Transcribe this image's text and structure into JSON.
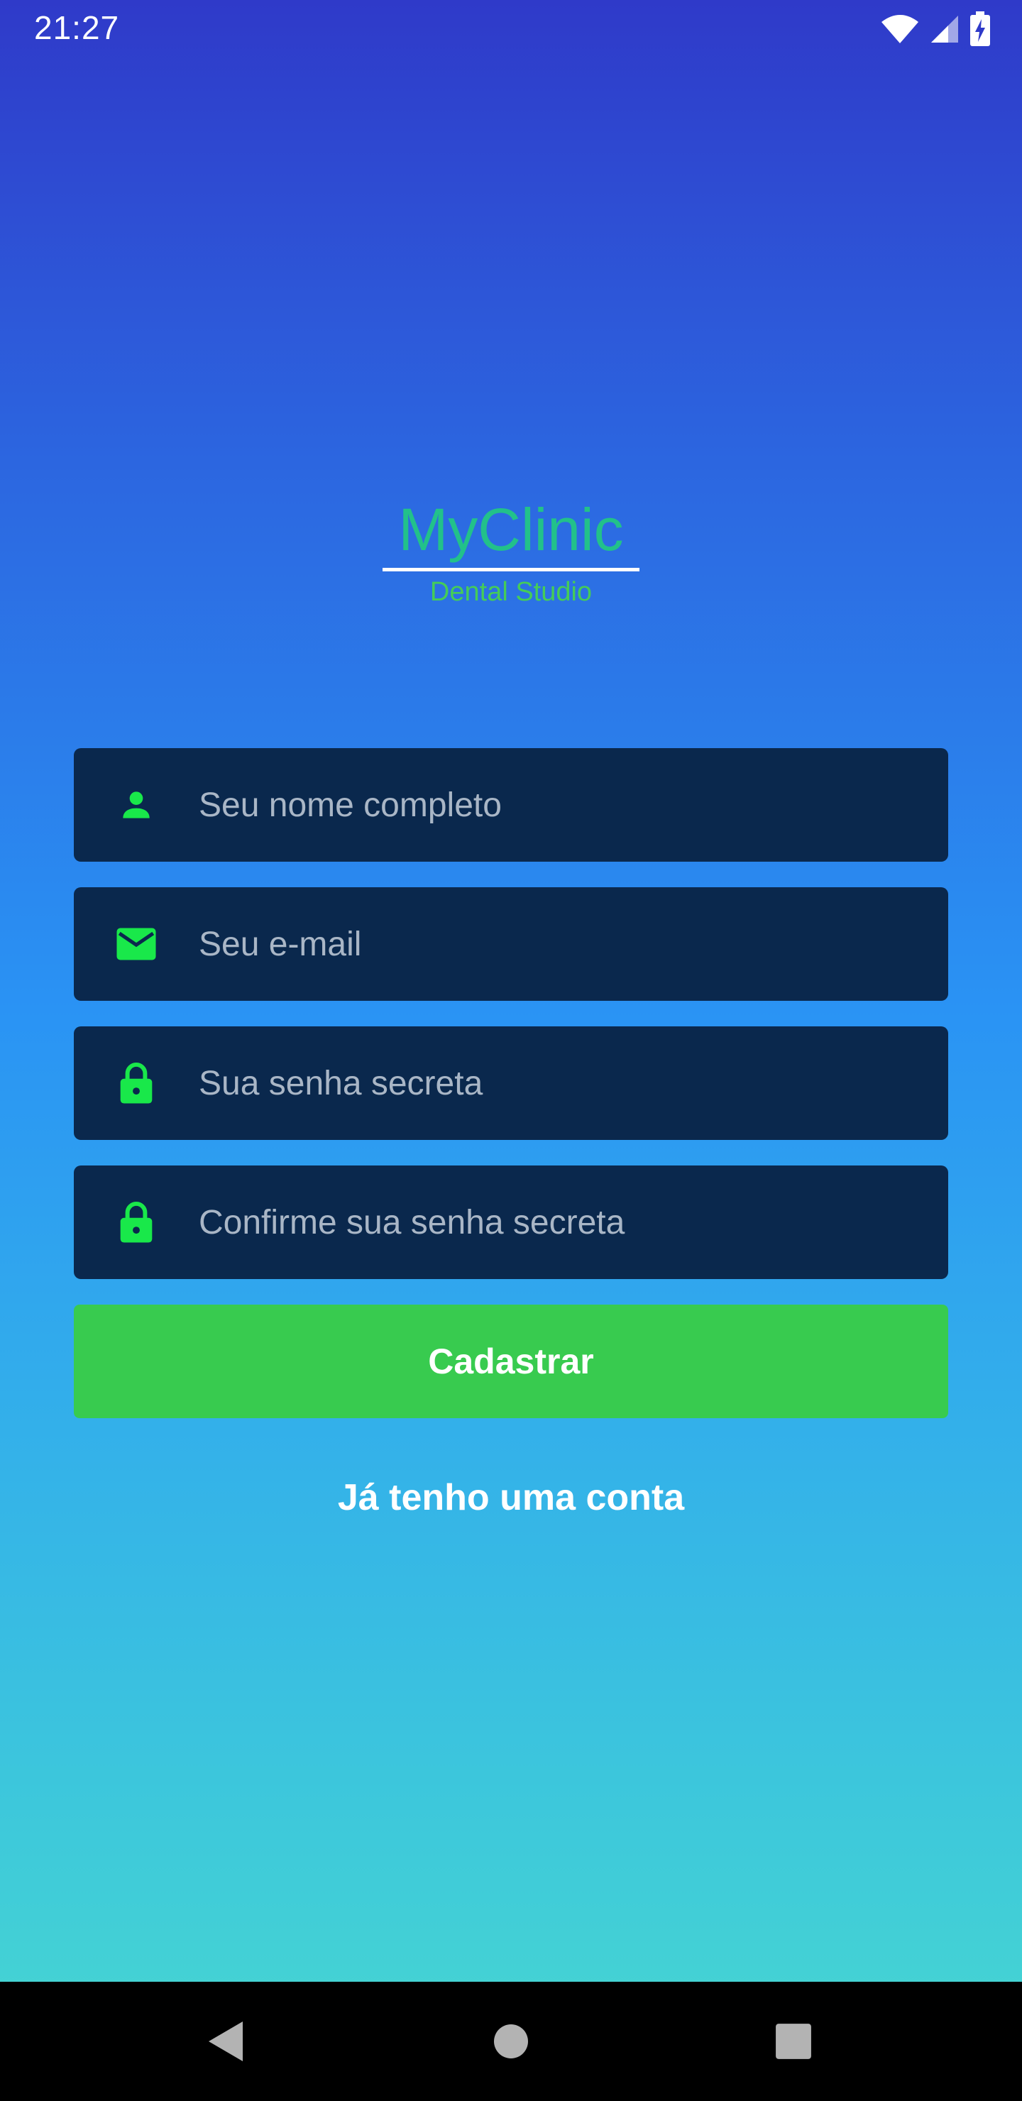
{
  "status_bar": {
    "time": "21:27",
    "icons": [
      "wifi-icon",
      "cellular-signal-icon",
      "battery-charging-icon"
    ]
  },
  "logo": {
    "title": "MyClinic",
    "subtitle": "Dental Studio"
  },
  "form": {
    "name_placeholder": "Seu nome completo",
    "email_placeholder": "Seu e-mail",
    "password_placeholder": "Sua senha secreta",
    "confirm_password_placeholder": "Confirme sua senha secreta",
    "submit_label": "Cadastrar",
    "login_link_label": "Já tenho uma conta",
    "icons": [
      "person-icon",
      "mail-icon",
      "lock-icon",
      "lock-icon"
    ]
  },
  "nav_bar": {
    "icons": [
      "back-icon",
      "home-icon",
      "recents-icon"
    ]
  },
  "colors": {
    "gradient_top": "#2f3ac9",
    "gradient_bottom": "#48d8d0",
    "field_bg": "#0a284d",
    "icon_green": "#19e84a",
    "button_green": "#38cb4f",
    "logo_title": "#22c18a",
    "logo_subtitle": "#45cc58"
  }
}
